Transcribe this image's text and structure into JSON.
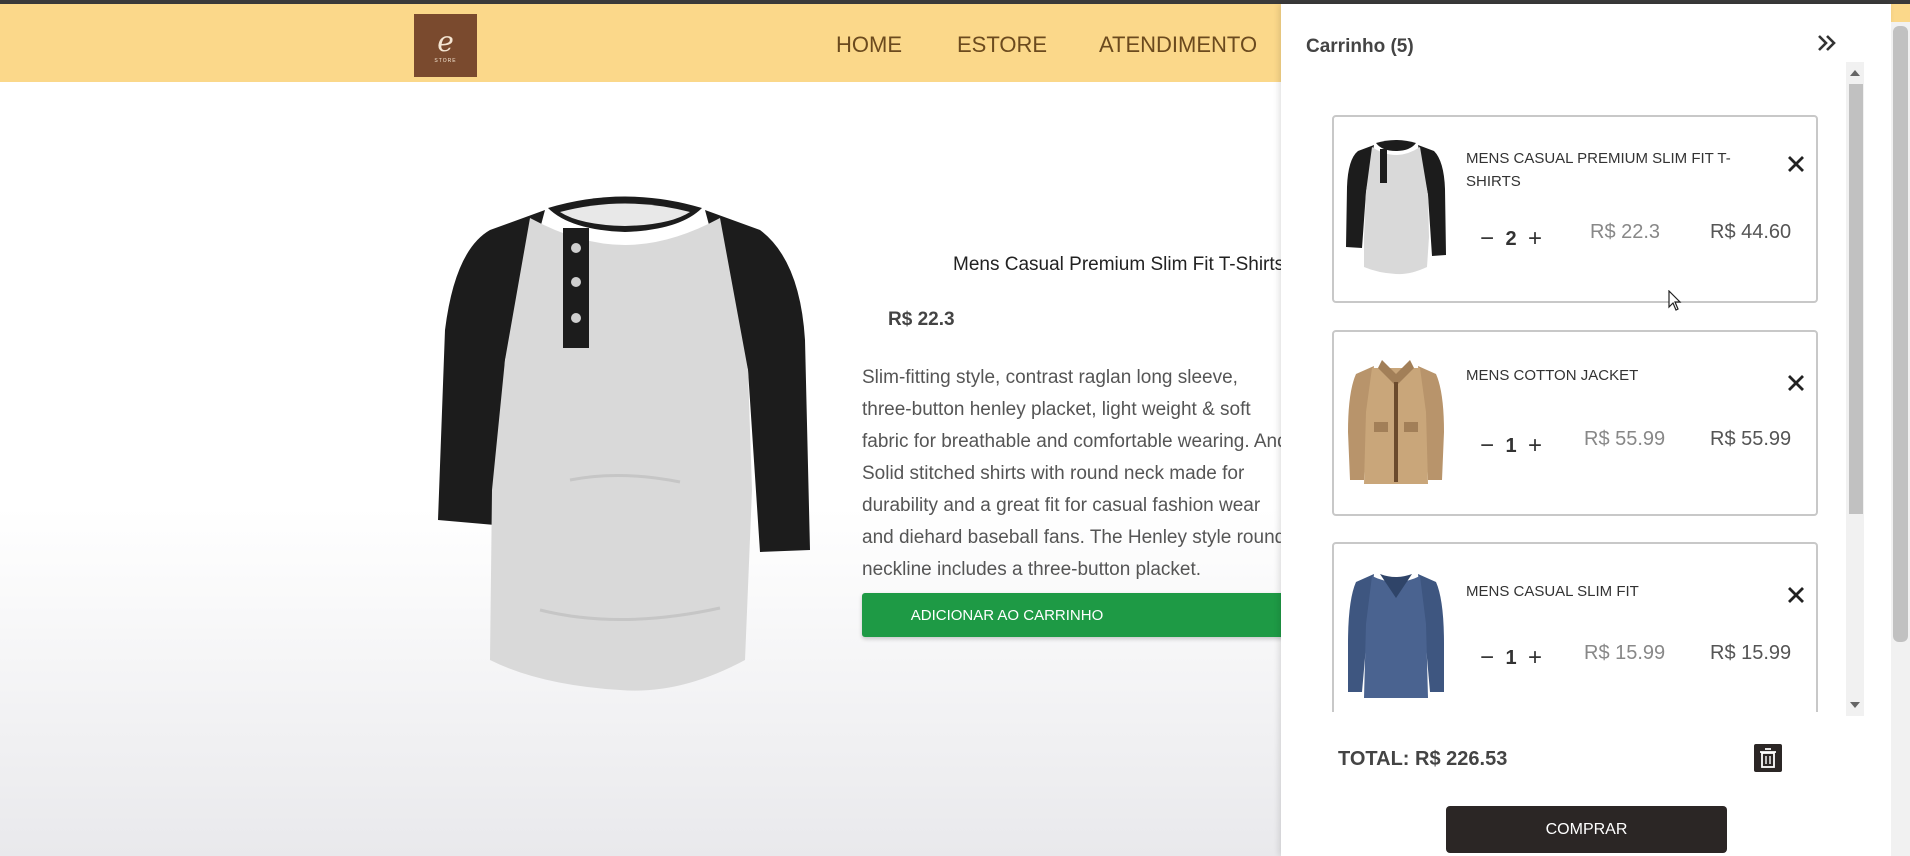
{
  "nav": {
    "logo_mark": "e",
    "logo_sub": "STORE",
    "links": [
      "HOME",
      "ESTORE",
      "ATENDIMENTO"
    ]
  },
  "product": {
    "title": "Mens Casual Premium Slim Fit T-Shirts",
    "price": "R$ 22.3",
    "description": "Slim-fitting style, contrast raglan long sleeve, three-button henley placket, light weight & soft fabric for breathable and comfortable wearing. And Solid stitched shirts with round neck made for durability and a great fit for casual fashion wear and diehard baseball fans. The Henley style round neckline includes a three-button placket.",
    "add_button": "ADICIONAR AO CARRINHO",
    "image_icon": "raglan-tshirt-image"
  },
  "cart": {
    "title": "Carrinho (5)",
    "items": [
      {
        "name": "MENS CASUAL PREMIUM SLIM FIT T-SHIRTS",
        "qty": "2",
        "unit_price": "R$ 22.3",
        "line_total": "R$ 44.60",
        "image": "raglan-tshirt"
      },
      {
        "name": "MENS COTTON JACKET",
        "qty": "1",
        "unit_price": "R$ 55.99",
        "line_total": "R$ 55.99",
        "image": "cotton-jacket"
      },
      {
        "name": "MENS CASUAL SLIM FIT",
        "qty": "1",
        "unit_price": "R$ 15.99",
        "line_total": "R$ 15.99",
        "image": "blue-longsleeve"
      }
    ],
    "minus": "−",
    "plus": "+",
    "total": "TOTAL: R$ 226.53",
    "buy_button": "COMPRAR"
  },
  "colors": {
    "navbar": "#fbd88a",
    "logo_bg": "#7a4a2e",
    "add_button": "#1e9a45",
    "buy_button": "#2b2625"
  }
}
